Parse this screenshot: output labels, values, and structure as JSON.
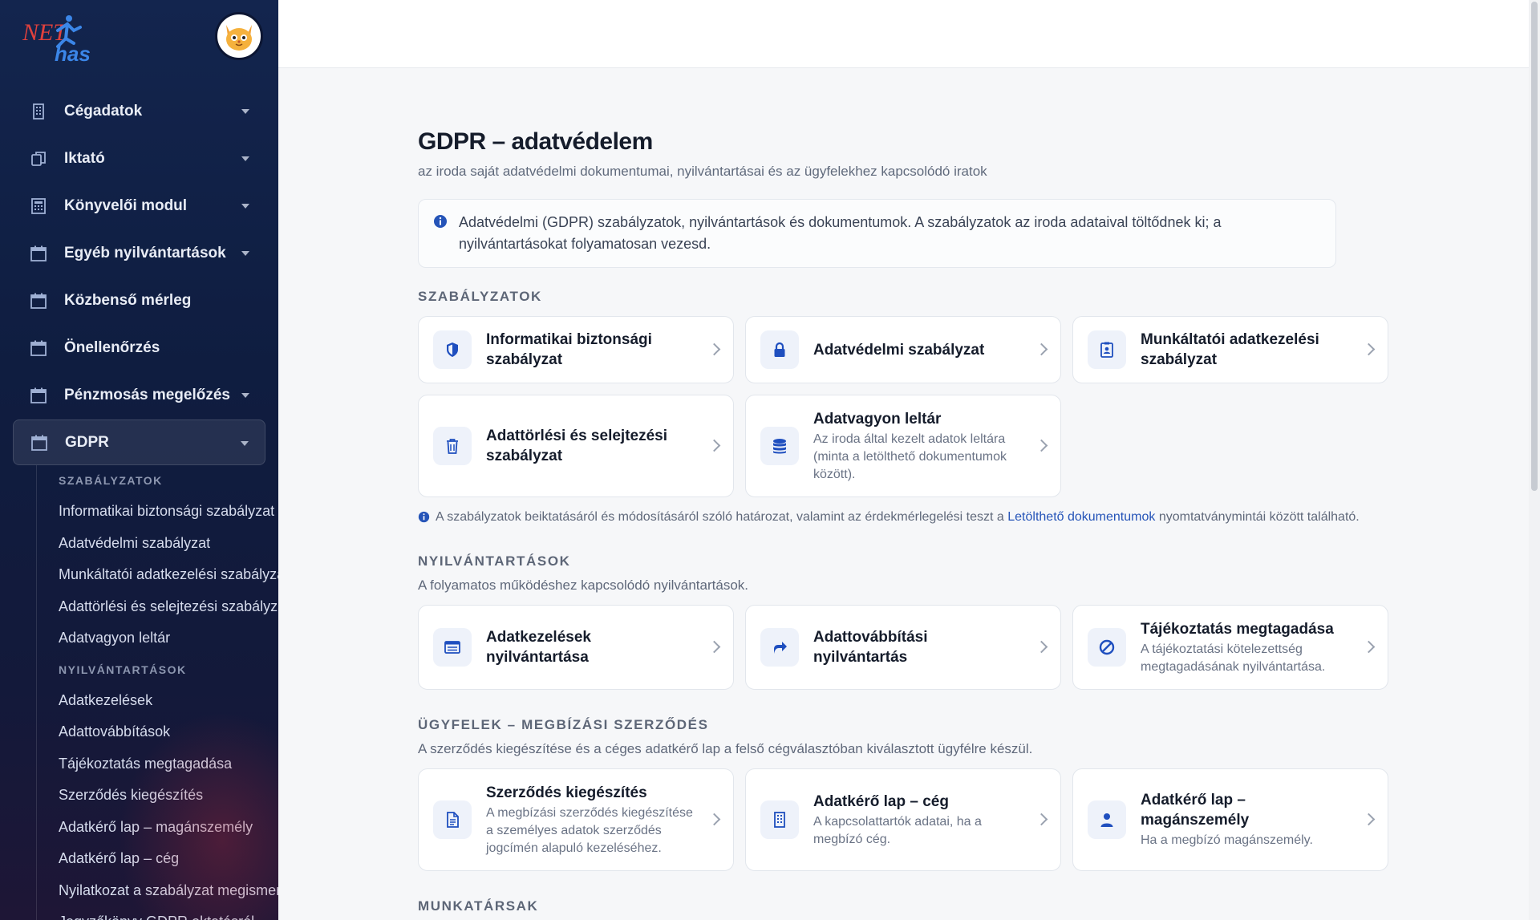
{
  "sidebar": {
    "logo_alt": "NET has",
    "nav": [
      {
        "label": "Cégadatok",
        "icon": "building-icon",
        "has_caret": true
      },
      {
        "label": "Iktató",
        "icon": "documents-icon",
        "has_caret": true
      },
      {
        "label": "Könyvelői modul",
        "icon": "calculator-icon",
        "has_caret": true
      },
      {
        "label": "Egyéb nyilvántartások",
        "icon": "calendar-icon",
        "has_caret": true
      },
      {
        "label": "Közbenső mérleg",
        "icon": "calendar-icon",
        "has_caret": false
      },
      {
        "label": "Önellenőrzés",
        "icon": "calendar-icon",
        "has_caret": false
      },
      {
        "label": "Pénzmosás megelőzés",
        "icon": "calendar-icon",
        "has_caret": true
      },
      {
        "label": "GDPR",
        "icon": "calendar-icon",
        "has_caret": true,
        "active": true
      }
    ],
    "submenu": {
      "head1": "SZABÁLYZATOK",
      "items1": [
        "Informatikai biztonsági szabályzat",
        "Adatvédelmi szabályzat",
        "Munkáltatói adatkezelési szabályzat",
        "Adattörlési és selejtezési szabályzat",
        "Adatvagyon leltár"
      ],
      "head2": "NYILVÁNTARTÁSOK",
      "items2": [
        "Adatkezelések",
        "Adattovábbítások",
        "Tájékoztatás megtagadása",
        "Szerződés kiegészítés",
        "Adatkérő lap – magánszemély",
        "Adatkérő lap – cég",
        "Nyilatkozat a szabályzat megismerés",
        "Jegyzőkönyv GDPR oktatásról"
      ]
    }
  },
  "page": {
    "title": "GDPR – adatvédelem",
    "subtitle": "az iroda saját adatvédelmi dokumentumai, nyilvántartásai és az ügyfelekhez kapcsolódó iratok",
    "info": "Adatvédelmi (GDPR) szabályzatok, nyilvántartások és dokumentumok. A szabályzatok az iroda adataival töltődnek ki; a nyilvántartásokat folyamatosan vezesd."
  },
  "sections": {
    "policies": {
      "title": "SZABÁLYZATOK",
      "cards": [
        {
          "title": "Informatikai biztonsági szabályzat",
          "desc": "",
          "icon": "shield-icon"
        },
        {
          "title": "Adatvédelmi szabályzat",
          "desc": "",
          "icon": "lock-icon"
        },
        {
          "title": "Munkáltatói adatkezelési szabályzat",
          "desc": "",
          "icon": "id-badge-icon"
        },
        {
          "title": "Adattörlési és selejtezési szabályzat",
          "desc": "",
          "icon": "trash-icon"
        },
        {
          "title": "Adatvagyon leltár",
          "desc": "Az iroda által kezelt adatok leltára (minta a letölthető dokumentumok között).",
          "icon": "database-icon"
        }
      ],
      "note_before": "A szabályzatok beiktatásáról és módosításáról szóló határozat, valamint az érdekmérlegelési teszt a",
      "note_link": "Letölthető dokumentumok",
      "note_after": "nyomtatványmintái között található."
    },
    "registers": {
      "title": "NYILVÁNTARTÁSOK",
      "subtitle": "A folyamatos működéshez kapcsolódó nyilvántartások.",
      "cards": [
        {
          "title": "Adatkezelések nyilvántartása",
          "desc": "",
          "icon": "list-icon"
        },
        {
          "title": "Adattovábbítási nyilvántartás",
          "desc": "",
          "icon": "share-arrow-icon"
        },
        {
          "title": "Tájékoztatás megtagadása",
          "desc": "A tájékoztatási kötelezettség megtagadásának nyilvántartása.",
          "icon": "ban-icon"
        }
      ]
    },
    "clients": {
      "title": "ÜGYFELEK – MEGBÍZÁSI SZERZŐDÉS",
      "subtitle": "A szerződés kiegészítése és a céges adatkérő lap a felső cégválasztóban kiválasztott ügyfélre készül.",
      "cards": [
        {
          "title": "Szerződés kiegészítés",
          "desc": "A megbízási szerződés kiegészítése a személyes adatok szerződés jogcímén alapuló kezeléséhez.",
          "icon": "document-icon"
        },
        {
          "title": "Adatkérő lap – cég",
          "desc": "A kapcsolattartók adatai, ha a megbízó cég.",
          "icon": "building-icon"
        },
        {
          "title": "Adatkérő lap – magánszemély",
          "desc": "Ha a megbízó magánszemély.",
          "icon": "person-icon"
        }
      ]
    },
    "staff": {
      "title": "MUNKATÁRSAK"
    }
  },
  "colors": {
    "accent": "#2554b8",
    "sidebar_bg": "#13254e",
    "icon_blue": "#1f4fbf"
  }
}
